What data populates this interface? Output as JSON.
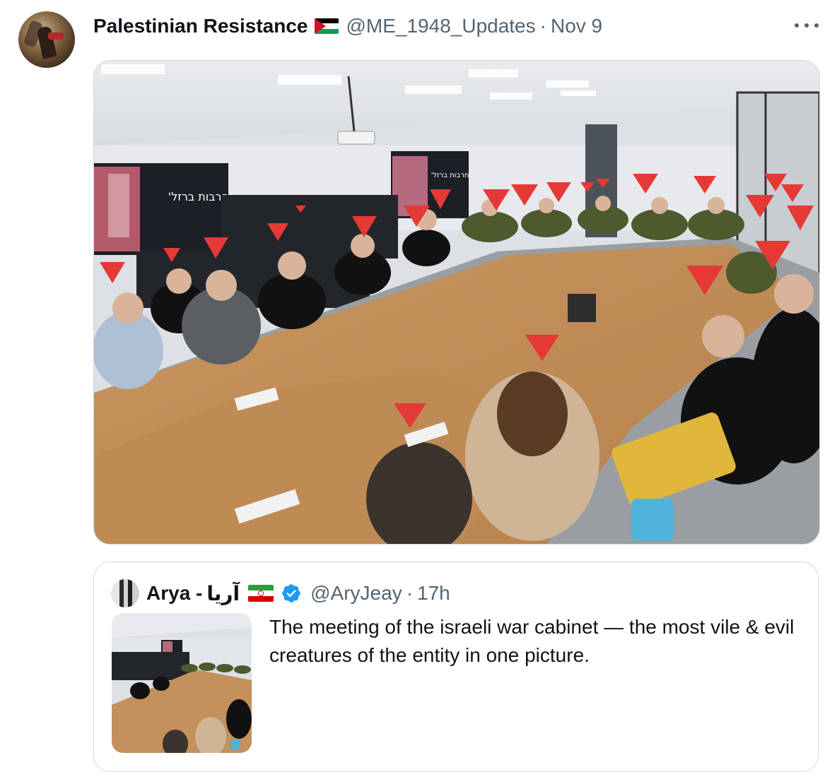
{
  "post": {
    "display_name": "Palestinian Resistance",
    "handle": "@ME_1948_Updates",
    "separator": "·",
    "date": "Nov 9",
    "flag_icon": "palestine-flag-icon",
    "colors": {
      "palestine_flag": [
        "#000000",
        "#ffffff",
        "#149954",
        "#ce1126"
      ]
    }
  },
  "media": {
    "hebrew_sign": "'חרבות ברזל'"
  },
  "quoted": {
    "display_name": "Arya -",
    "arabic_name": "آریا",
    "flag_icon": "iran-flag-icon",
    "verified_icon": "verified-badge-icon",
    "handle": "@AryJeay",
    "separator": "·",
    "time": "17h",
    "text": "The meeting of the israeli war cabinet — the most vile & evil creatures of the entity in one picture.",
    "colors": {
      "verified": "#1d9bf0",
      "iran_flag": [
        "#239f40",
        "#ffffff",
        "#da0000"
      ]
    }
  }
}
